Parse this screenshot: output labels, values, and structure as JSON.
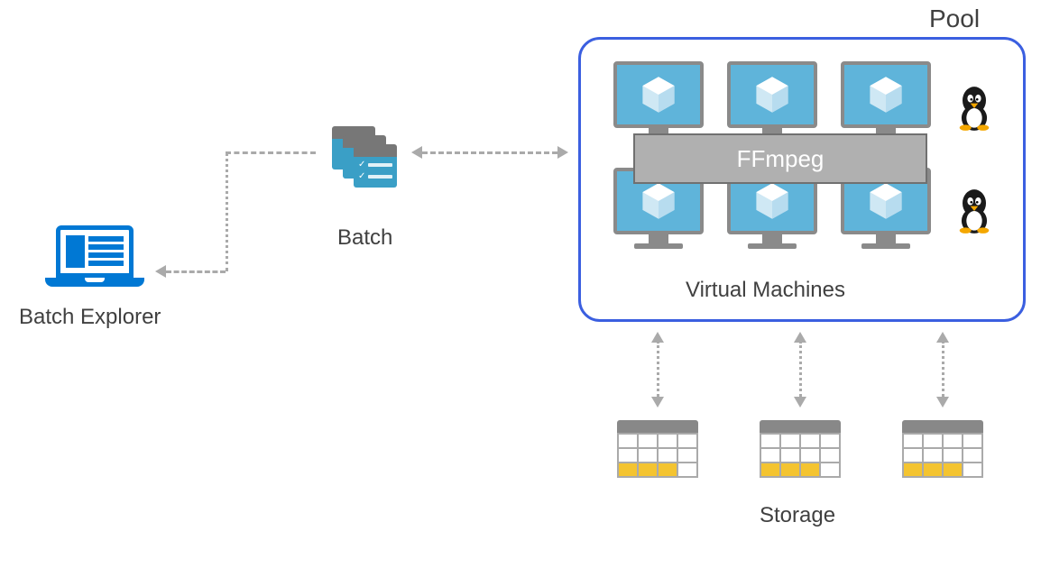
{
  "labels": {
    "batch_explorer": "Batch Explorer",
    "batch": "Batch",
    "pool": "Pool",
    "ffmpeg": "FFmpeg",
    "virtual_machines": "Virtual Machines",
    "storage": "Storage"
  },
  "colors": {
    "azure_blue": "#0078d4",
    "pool_border": "#3b5fe0",
    "vm_screen": "#5fb4da",
    "storage_highlight": "#f4c430",
    "neutral_gray": "#888888"
  },
  "diagram": {
    "vm_rows": 2,
    "vm_cols": 3,
    "storage_count": 3,
    "linux_icons": 2
  }
}
